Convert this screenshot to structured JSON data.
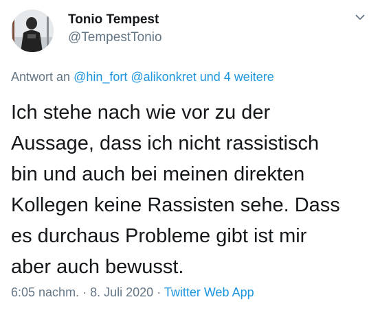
{
  "author": {
    "display_name": "Tonio Tempest",
    "handle": "@TempestTonio",
    "avatar_icon": "profile-photo"
  },
  "menu_icon": "chevron-down-icon",
  "reply": {
    "prefix": "Antwort an",
    "mentions": [
      "@hin_fort",
      "@alikonkret"
    ],
    "more": "und 4 weitere"
  },
  "tweet": {
    "text": "Ich stehe nach wie vor zu der\nAussage, dass ich nicht rassistisch\nbin und auch bei meinen direkten\nKollegen keine Rassisten sehe. Dass\nes durchaus Probleme gibt ist mir\naber auch bewusst."
  },
  "meta": {
    "time": "6:05 nachm.",
    "separator": "·",
    "date": "8. Juli 2020",
    "source": "Twitter Web App"
  },
  "colors": {
    "text": "#14171a",
    "secondary": "#657786",
    "link": "#1b95e0"
  }
}
